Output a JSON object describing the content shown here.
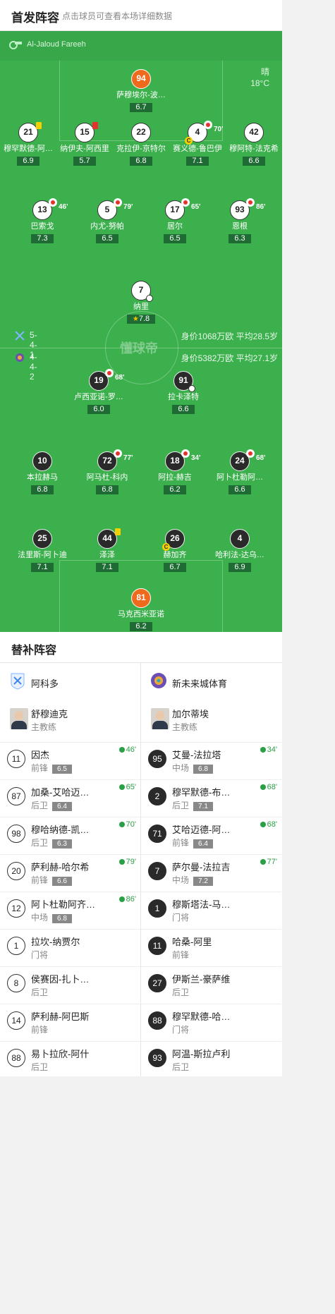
{
  "header": {
    "title": "首发阵容",
    "subtitle": "点击球员可查看本场详细数据"
  },
  "referee": {
    "name": "Al-Jaloud Fareeh"
  },
  "weather": {
    "condition": "晴",
    "temp": "18°C"
  },
  "watermark": "懂球帝",
  "home_summary": {
    "formation": "5-4-1",
    "value": "身价1068万欧 平均28.5岁"
  },
  "away_summary": {
    "formation": "4-4-2",
    "value": "身价5382万欧 平均27.1岁"
  },
  "home": {
    "gk": {
      "num": "94",
      "name": "萨穆埃尔-波…",
      "rating": "6.7"
    },
    "def": [
      {
        "num": "21",
        "name": "穆罕默德-阿…",
        "rating": "6.9",
        "card": "yellow"
      },
      {
        "num": "15",
        "name": "纳伊夫-阿西里",
        "rating": "5.7",
        "card": "red"
      },
      {
        "num": "22",
        "name": "克拉伊-京特尔",
        "rating": "6.8"
      },
      {
        "num": "4",
        "name": "赛义德-鲁巴伊",
        "rating": "7.1",
        "sub": "70'",
        "captain": "C"
      },
      {
        "num": "42",
        "name": "穆阿特-法克希",
        "rating": "6.6"
      }
    ],
    "mid": [
      {
        "num": "13",
        "name": "巴索戈",
        "rating": "7.3",
        "sub": "46'"
      },
      {
        "num": "5",
        "name": "内尤-努帕",
        "rating": "6.5",
        "sub": "79'",
        "card": "yellow"
      },
      {
        "num": "17",
        "name": "居尔",
        "rating": "6.5",
        "sub": "65'"
      },
      {
        "num": "93",
        "name": "恩根",
        "rating": "6.3",
        "sub": "86'"
      }
    ],
    "fw": {
      "num": "7",
      "name": "纳里",
      "rating": "7.8"
    }
  },
  "away": {
    "fw": [
      {
        "num": "19",
        "name": "卢西亚诺-罗…",
        "rating": "6.0",
        "sub": "68'"
      },
      {
        "num": "91",
        "name": "拉卡泽特",
        "rating": "6.6"
      }
    ],
    "mid": [
      {
        "num": "10",
        "name": "本拉赫马",
        "rating": "6.8"
      },
      {
        "num": "72",
        "name": "阿马杜-科内",
        "rating": "6.8",
        "sub": "77'"
      },
      {
        "num": "18",
        "name": "阿拉-赫吉",
        "rating": "6.2",
        "sub": "34'"
      },
      {
        "num": "24",
        "name": "阿卜杜勒阿…",
        "rating": "6.6",
        "sub": "68'"
      }
    ],
    "def": [
      {
        "num": "25",
        "name": "法里斯-阿卜迪",
        "rating": "7.1"
      },
      {
        "num": "44",
        "name": "泽泽",
        "rating": "7.1",
        "card": "yellow"
      },
      {
        "num": "26",
        "name": "赫加齐",
        "rating": "6.7",
        "captain": "C"
      },
      {
        "num": "4",
        "name": "哈利法-达乌…",
        "rating": "6.9"
      }
    ],
    "gk": {
      "num": "81",
      "name": "马克西米亚诺",
      "rating": "6.2"
    }
  },
  "subs": {
    "title": "替补阵容",
    "home_team": "阿科多",
    "away_team": "新未来城体育",
    "home_coach": {
      "name": "舒穆迪克",
      "role": "主教练"
    },
    "away_coach": {
      "name": "加尔蒂埃",
      "role": "主教练"
    },
    "home": [
      {
        "num": "11",
        "name": "因杰",
        "pos": "前锋",
        "rating": "6.5",
        "in": "46'"
      },
      {
        "num": "87",
        "name": "加桑-艾哈迈…",
        "pos": "后卫",
        "rating": "6.4",
        "in": "65'"
      },
      {
        "num": "98",
        "name": "穆哈纳德-凯…",
        "pos": "后卫",
        "rating": "6.3",
        "in": "70'"
      },
      {
        "num": "20",
        "name": "萨利赫-哈尔希",
        "pos": "前锋",
        "rating": "6.6",
        "in": "79'"
      },
      {
        "num": "12",
        "name": "阿卜杜勒阿齐…",
        "pos": "中场",
        "rating": "6.8",
        "in": "86'"
      },
      {
        "num": "1",
        "name": "拉坎-纳贾尔",
        "pos": "门将"
      },
      {
        "num": "8",
        "name": "侯赛因-扎卜…",
        "pos": "后卫"
      },
      {
        "num": "14",
        "name": "萨利赫-阿巴斯",
        "pos": "前锋"
      },
      {
        "num": "88",
        "name": "易卜拉欣-阿什",
        "pos": "后卫"
      }
    ],
    "away": [
      {
        "num": "95",
        "name": "艾曼-法拉塔",
        "pos": "中场",
        "rating": "6.8",
        "in": "34'"
      },
      {
        "num": "2",
        "name": "穆罕默德-布…",
        "pos": "后卫",
        "rating": "7.1",
        "in": "68'"
      },
      {
        "num": "71",
        "name": "艾哈迈德-阿…",
        "pos": "前锋",
        "rating": "6.4",
        "in": "68'"
      },
      {
        "num": "7",
        "name": "萨尔曼-法拉吉",
        "pos": "中场",
        "rating": "7.2",
        "in": "77'"
      },
      {
        "num": "1",
        "name": "穆斯塔法-马…",
        "pos": "门将"
      },
      {
        "num": "11",
        "name": "哈桑-阿里",
        "pos": "前锋"
      },
      {
        "num": "27",
        "name": "伊斯兰-豪萨维",
        "pos": "后卫"
      },
      {
        "num": "88",
        "name": "穆罕默德-哈…",
        "pos": "门将"
      },
      {
        "num": "93",
        "name": "阿温-斯拉卢利",
        "pos": "后卫"
      }
    ]
  }
}
